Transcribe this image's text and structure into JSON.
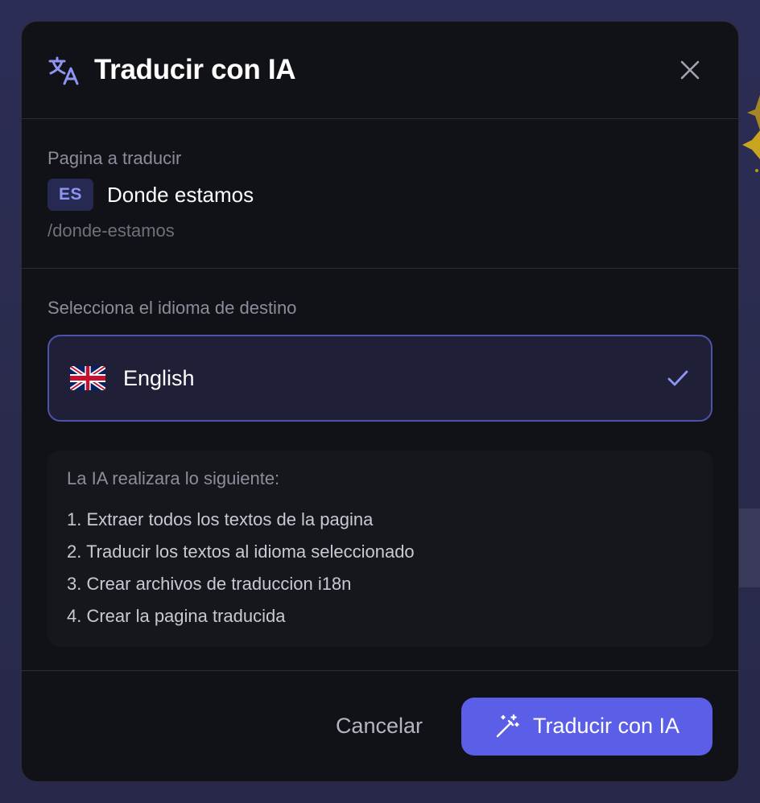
{
  "modal": {
    "title": "Traducir con IA",
    "title_icon": "translate-icon",
    "close_icon": "close-icon"
  },
  "page_section": {
    "label": "Pagina a traducir",
    "lang_badge": "ES",
    "page_name": "Donde estamos",
    "page_path": "/donde-estamos"
  },
  "target": {
    "label": "Selecciona el idioma de destino",
    "selected": {
      "name": "English",
      "flag_icon": "uk-flag-icon",
      "check_icon": "check-icon"
    }
  },
  "info": {
    "title": "La IA realizara lo siguiente:",
    "steps": [
      "1. Extraer todos los textos de la pagina",
      "2. Traducir los textos al idioma seleccionado",
      "3. Crear archivos de traduccion i18n",
      "4. Crear la pagina traducida"
    ]
  },
  "footer": {
    "cancel_label": "Cancelar",
    "submit_label": "Traducir con IA",
    "submit_icon": "magic-wand-icon"
  },
  "colors": {
    "accent": "#5b5ee6",
    "modal_bg": "#111217",
    "badge_bg": "#262a52",
    "selected_border": "#4d52a8"
  }
}
